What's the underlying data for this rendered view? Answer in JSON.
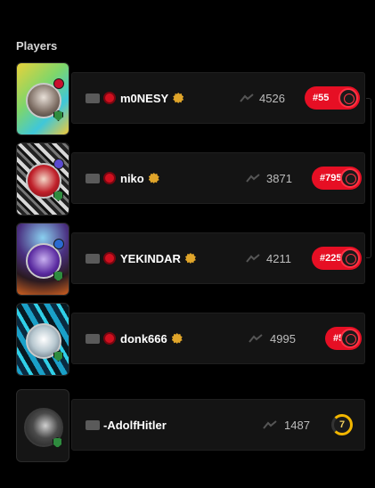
{
  "section": {
    "title": "Players"
  },
  "players": [
    {
      "nickname": "m0NESY",
      "elo": "4526",
      "rank": "#55",
      "level_type": "challenger"
    },
    {
      "nickname": "niko",
      "elo": "3871",
      "rank": "#795",
      "level_type": "challenger"
    },
    {
      "nickname": "YEKINDAR",
      "elo": "4211",
      "rank": "#225",
      "level_type": "challenger"
    },
    {
      "nickname": "donk666",
      "elo": "4995",
      "rank": "#5",
      "level_type": "challenger"
    },
    {
      "nickname": "-AdolfHitler",
      "elo": "1487",
      "level": "7",
      "level_type": "numeric"
    }
  ],
  "colors": {
    "background": "#000000",
    "panel": "#141414",
    "rank_pill": "#e60f24",
    "verified_badge": "#e0a52a",
    "level_yellow": "#f2b600"
  },
  "icons": {
    "country_flag": "country-flag-icon",
    "team_logo": "team-logo-icon",
    "verified": "verified-badge-icon",
    "elo_trend": "trend-icon",
    "level": "skill-level-icon"
  }
}
